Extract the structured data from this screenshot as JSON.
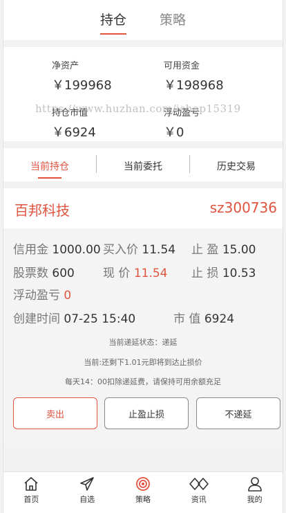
{
  "top_tabs": [
    {
      "label": "持仓",
      "active": true
    },
    {
      "label": "策略",
      "active": false
    }
  ],
  "summary": {
    "net_assets_label": "净资产",
    "net_assets_value": "￥199968",
    "available_label": "可用资金",
    "available_value": "￥198968",
    "market_value_label": "持仓市值",
    "market_value_value": "￥6924",
    "floating_pl_label": "浮动盈亏",
    "floating_pl_value": "￥0",
    "watermark": "https://www.huzhan.com/ishop15319"
  },
  "sub_tabs": [
    {
      "label": "当前持仓",
      "active": true
    },
    {
      "label": "当前委托",
      "active": false
    },
    {
      "label": "历史交易",
      "active": false
    }
  ],
  "position": {
    "name": "百邦科技",
    "code": "sz300736",
    "margin_label": "信用金",
    "margin_value": "1000.00",
    "buy_price_label": "买入价",
    "buy_price_value": "11.54",
    "take_profit_label": "止 盈",
    "take_profit_value": "15.00",
    "shares_label": "股票数",
    "shares_value": "600",
    "current_price_label": "现 价",
    "current_price_value": "11.54",
    "stop_loss_label": "止 损",
    "stop_loss_value": "10.53",
    "floating_pl_label": "浮动盈亏",
    "floating_pl_value": "0",
    "created_label": "创建时间",
    "created_value": "07-25 15:40",
    "market_value_label": "市 值",
    "market_value_value": "6924",
    "note_defer_status": "当前递延状态：递延",
    "note_remaining": "当前:还剩下1.01元即将到达止损价",
    "note_fee": "每天14：00扣除递延费，请保持可用余额充足",
    "sell_label": "卖出",
    "tp_sl_label": "止盈止损",
    "no_defer_label": "不递延"
  },
  "bottom_nav": [
    {
      "label": "首页",
      "icon": "home-icon"
    },
    {
      "label": "自选",
      "icon": "send-icon"
    },
    {
      "label": "策略",
      "icon": "strategy-icon",
      "active": true
    },
    {
      "label": "资讯",
      "icon": "news-icon"
    },
    {
      "label": "我的",
      "icon": "user-icon"
    }
  ],
  "colors": {
    "accent": "#e0533f",
    "background": "#f2f2f2"
  }
}
